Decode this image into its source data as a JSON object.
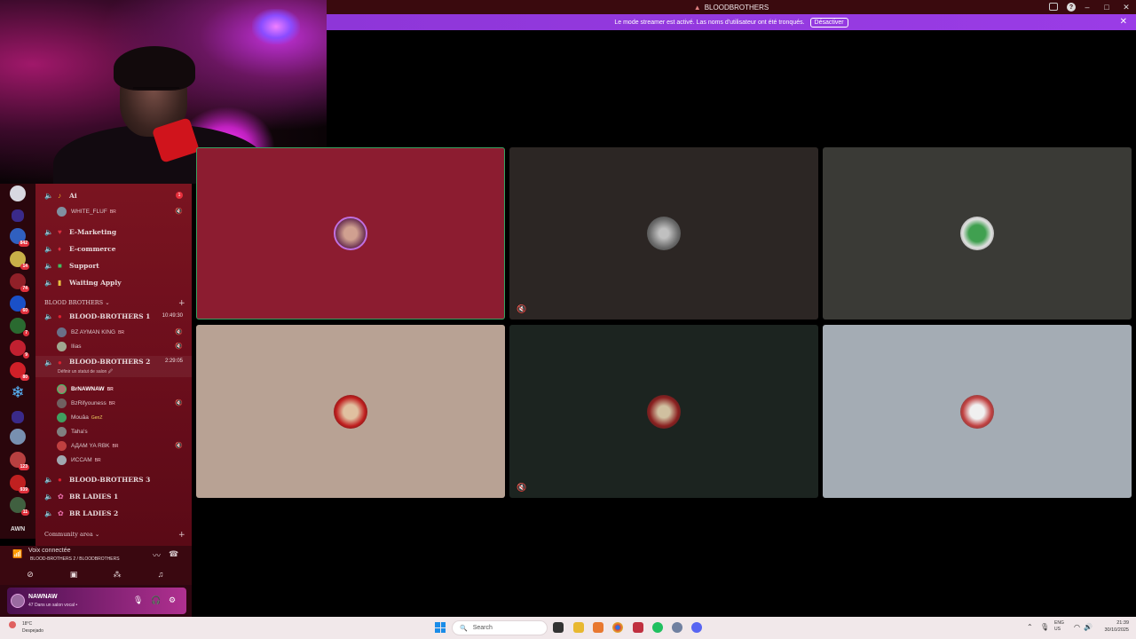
{
  "window": {
    "title": "BLOODBROTHERS",
    "minimize": "–",
    "maximize": "□",
    "close": "✕"
  },
  "banner": {
    "message": "Le mode streamer est activé. Las noms d'utilisateur ont été tronqués.",
    "button": "Désactiver",
    "close": "✕"
  },
  "servers": [
    {
      "badge": ""
    },
    {
      "badge": ""
    },
    {
      "badge": "842"
    },
    {
      "badge": "14"
    },
    {
      "badge": "74"
    },
    {
      "badge": "60"
    },
    {
      "badge": "7"
    },
    {
      "badge": "9"
    },
    {
      "badge": "80"
    },
    {
      "badge": ""
    },
    {
      "badge": ""
    },
    {
      "badge": ""
    },
    {
      "badge": "123"
    },
    {
      "badge": "939"
    },
    {
      "badge": "11"
    },
    {
      "badge": "AWN"
    }
  ],
  "channels": {
    "top": [
      {
        "name": "Ai",
        "badge": "1"
      },
      {
        "name": "E-Marketing"
      },
      {
        "name": "E-commerce"
      },
      {
        "name": "Support"
      },
      {
        "name": "Waiting Apply"
      }
    ],
    "ai_user": {
      "name": "WHITE_FLUF",
      "tag": "BR"
    },
    "category_blood": "BLOOD BROTHERS",
    "bb1": {
      "name": "BLOOD-BROTHERS 1",
      "time": "10:49:30"
    },
    "bb1_users": [
      {
        "name": "BZ AYMAN KING",
        "tag": "BR"
      },
      {
        "name": "Ilias",
        "tag": ""
      }
    ],
    "bb2": {
      "name": "BLOOD-BROTHERS 2",
      "time": "2:29:05",
      "status": "Définir un statut de salon 🖉"
    },
    "bb2_users": [
      {
        "name": "BrNAWNAW",
        "tag": "BR"
      },
      {
        "name": "BzRifyouness",
        "tag": "BR"
      },
      {
        "name": "Mouâa",
        "tag": "GenZ"
      },
      {
        "name": "Taha's",
        "tag": ""
      },
      {
        "name": "АДАМ YA RBK",
        "tag": "BR"
      },
      {
        "name": "ИССАМ",
        "tag": "BR"
      }
    ],
    "bb3": {
      "name": "BLOOD-BROTHERS 3"
    },
    "ladies1": {
      "name": "BR LADIES 1"
    },
    "ladies2": {
      "name": "BR LADIES 2"
    },
    "category_community": "Community area"
  },
  "voice": {
    "status": "Voix connectée",
    "channel": "BLOOD-BROTHERS 2 / BLOODBROTHERS"
  },
  "user": {
    "name": "NAWNAW",
    "status": "47 Dans un salon vocal •"
  },
  "taskbar": {
    "temp": "18°C",
    "weather": "Despejado",
    "search": "Search",
    "lang1": "ENG",
    "lang2": "US",
    "time": "21:39",
    "date": "30/10/2025"
  },
  "colors": {
    "banner": "#9a3ce6",
    "speaking_border": "#3aa060",
    "tile1": "#8c1c30",
    "tile2": "#2c2624",
    "tile3": "#3a3a36",
    "tile4": "#b8a294",
    "tile5": "#1c2420",
    "tile6": "#a4acb4"
  }
}
